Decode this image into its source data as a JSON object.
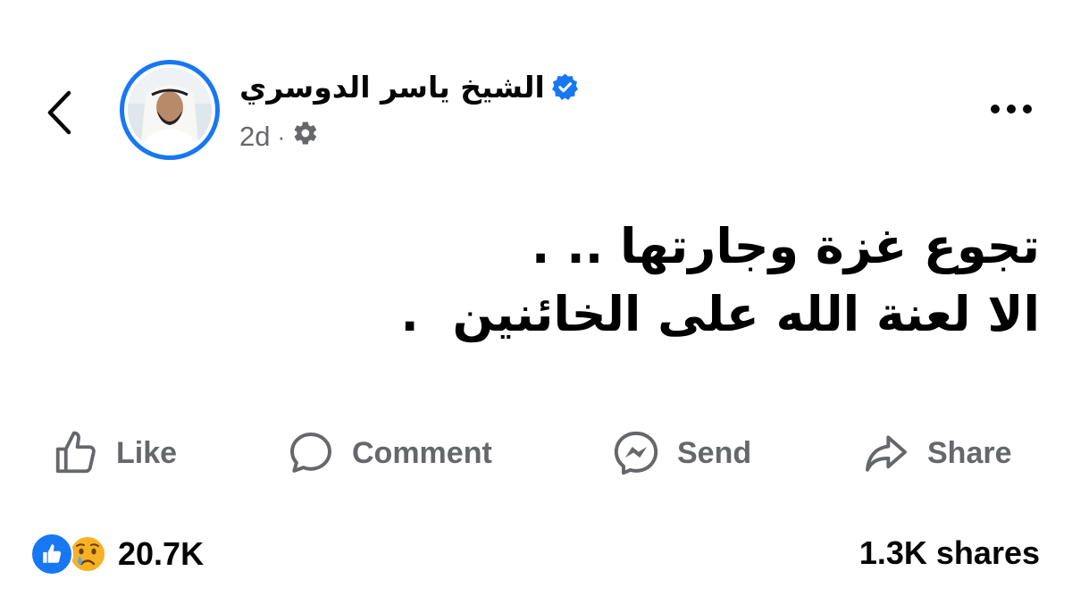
{
  "header": {
    "author_name": "الشيخ ياسر الدوسري",
    "timestamp": "2d",
    "separator": "·",
    "audience_icon": "gear-icon",
    "verified_icon": "verified-badge-icon",
    "back_icon": "chevron-left-icon",
    "more_icon": "more-horizontal-icon"
  },
  "post": {
    "line1": "تجوع غزة وجارتها .. .",
    "line2": "الا لعنة الله على الخائنين  ."
  },
  "actions": {
    "like_label": "Like",
    "comment_label": "Comment",
    "send_label": "Send",
    "share_label": "Share"
  },
  "engagement": {
    "reaction_icons": [
      "like-reaction-icon",
      "sad-reaction-icon"
    ],
    "reaction_count": "20.7K",
    "shares": "1.3K shares"
  },
  "colors": {
    "brand_blue": "#1877f2",
    "secondary_text": "#65676b",
    "primary_text": "#050505"
  }
}
